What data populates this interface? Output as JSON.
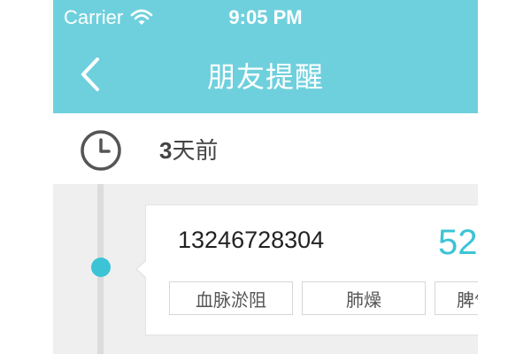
{
  "status_bar": {
    "carrier": "Carrier",
    "wifi_icon": "wifi-icon",
    "time": "9:05 PM"
  },
  "nav": {
    "back_icon": "chevron-left-icon",
    "title": "朋友提醒"
  },
  "time_row": {
    "clock_icon": "clock-icon",
    "number": "3",
    "unit": "天前"
  },
  "card": {
    "phone": "13246728304",
    "score": "52",
    "tags": [
      "血脉淤阻",
      "肺燥",
      "脾气"
    ]
  },
  "colors": {
    "header_bg": "#6fd0dd",
    "accent": "#3cc4d6"
  }
}
